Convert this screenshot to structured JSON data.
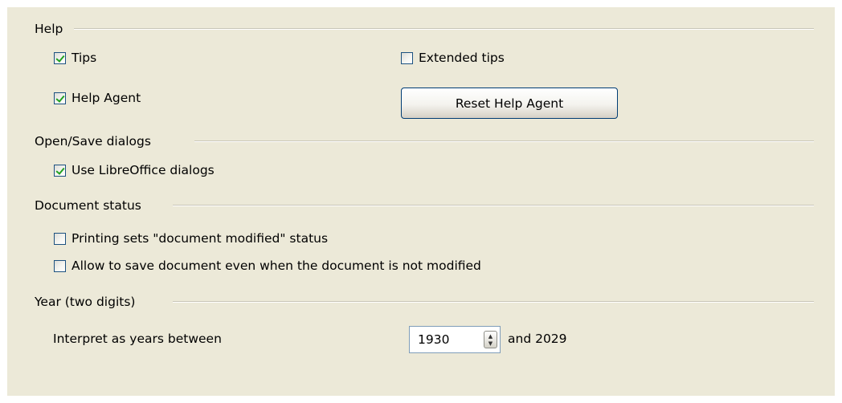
{
  "help": {
    "title": "Help",
    "tips": {
      "label": "Tips",
      "checked": true
    },
    "extended_tips": {
      "label": "Extended tips",
      "checked": false
    },
    "help_agent": {
      "label": "Help Agent",
      "checked": true
    },
    "reset_button": "Reset Help Agent"
  },
  "open_save": {
    "title": "Open/Save dialogs",
    "use_dialogs": {
      "label": "Use LibreOffice dialogs",
      "checked": true
    }
  },
  "document_status": {
    "title": "Document status",
    "printing_sets": {
      "label": "Printing sets \"document modified\" status",
      "checked": false
    },
    "allow_save": {
      "label": "Allow to save document even when the document is not modified",
      "checked": false
    }
  },
  "year": {
    "title": "Year (two digits)",
    "interpret_label": "Interpret as years between",
    "start_year": "1930",
    "end_text": "and 2029"
  }
}
